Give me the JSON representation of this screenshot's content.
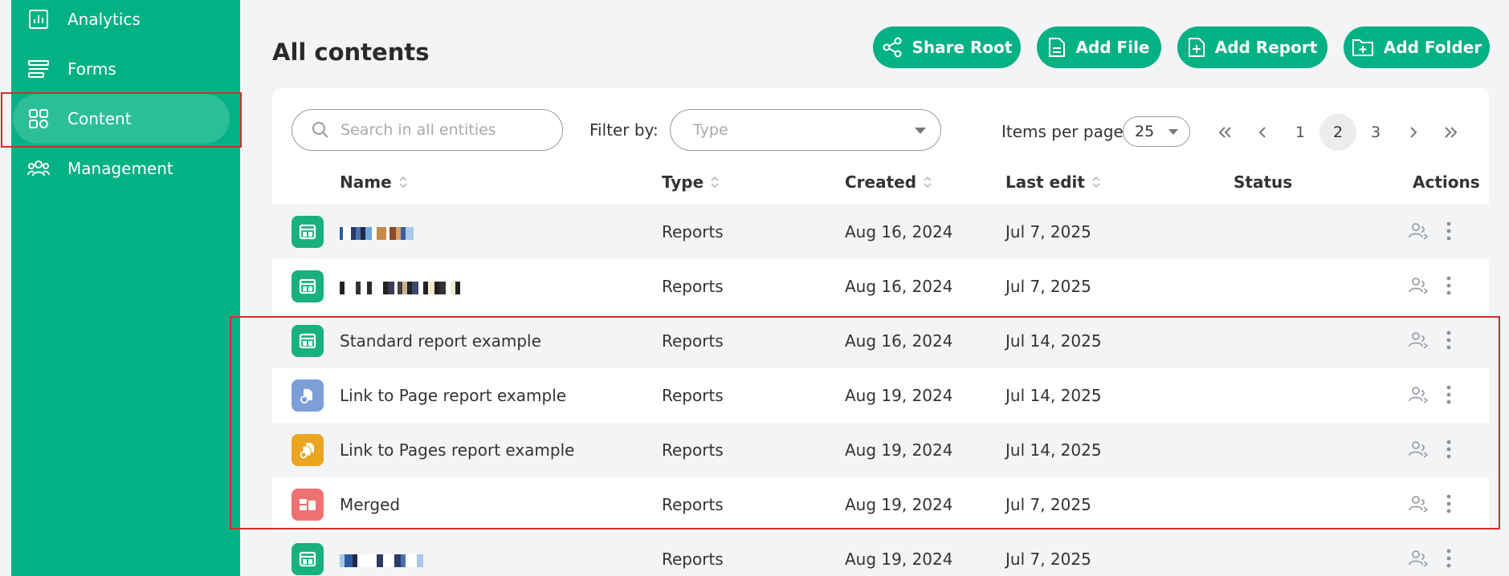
{
  "sidebar": {
    "items": [
      {
        "label": "Analytics",
        "icon": "chart-icon"
      },
      {
        "label": "Forms",
        "icon": "forms-icon"
      },
      {
        "label": "Content",
        "icon": "grid-icon",
        "active": true
      },
      {
        "label": "Management",
        "icon": "users-icon"
      }
    ]
  },
  "header": {
    "title": "All contents",
    "buttons": [
      {
        "label": "Share Root",
        "icon": "share-icon"
      },
      {
        "label": "Add File",
        "icon": "file-icon"
      },
      {
        "label": "Add Report",
        "icon": "add-report-icon"
      },
      {
        "label": "Add Folder",
        "icon": "add-folder-icon"
      }
    ]
  },
  "toolbar": {
    "search_placeholder": "Search in all entities",
    "filter_label": "Filter by:",
    "filter_placeholder": "Type",
    "items_per_page_label": "Items per page",
    "items_per_page_value": "25",
    "pages": [
      "1",
      "2",
      "3"
    ],
    "current_page": "2"
  },
  "table": {
    "columns": {
      "name": "Name",
      "type": "Type",
      "created": "Created",
      "last_edit": "Last edit",
      "status": "Status",
      "actions": "Actions"
    },
    "rows": [
      {
        "name": "",
        "type": "Reports",
        "created": "Aug 16, 2024",
        "last_edit": "Jul 7, 2025",
        "icon_color": "#18b07f",
        "icon": "report-icon",
        "redacted": true
      },
      {
        "name": "",
        "type": "Reports",
        "created": "Aug 16, 2024",
        "last_edit": "Jul 7, 2025",
        "icon_color": "#18b07f",
        "icon": "report-icon",
        "redacted": true
      },
      {
        "name": "Standard report example",
        "type": "Reports",
        "created": "Aug 16, 2024",
        "last_edit": "Jul 14, 2025",
        "icon_color": "#18b07f",
        "icon": "report-icon"
      },
      {
        "name": "Link to Page report example",
        "type": "Reports",
        "created": "Aug 19, 2024",
        "last_edit": "Jul 14, 2025",
        "icon_color": "#7d9fd8",
        "icon": "link-page-icon"
      },
      {
        "name": "Link to Pages report example",
        "type": "Reports",
        "created": "Aug 19, 2024",
        "last_edit": "Jul 14, 2025",
        "icon_color": "#eaa521",
        "icon": "link-pages-icon"
      },
      {
        "name": "Merged",
        "type": "Reports",
        "created": "Aug 19, 2024",
        "last_edit": "Jul 7, 2025",
        "icon_color": "#ee7272",
        "icon": "merged-icon"
      },
      {
        "name": "",
        "type": "Reports",
        "created": "Aug 19, 2024",
        "last_edit": "Jul 7, 2025",
        "icon_color": "#18b07f",
        "icon": "report-icon",
        "redacted": true
      }
    ]
  },
  "colors": {
    "brand": "#02b184",
    "highlight": "#d62b2b"
  }
}
